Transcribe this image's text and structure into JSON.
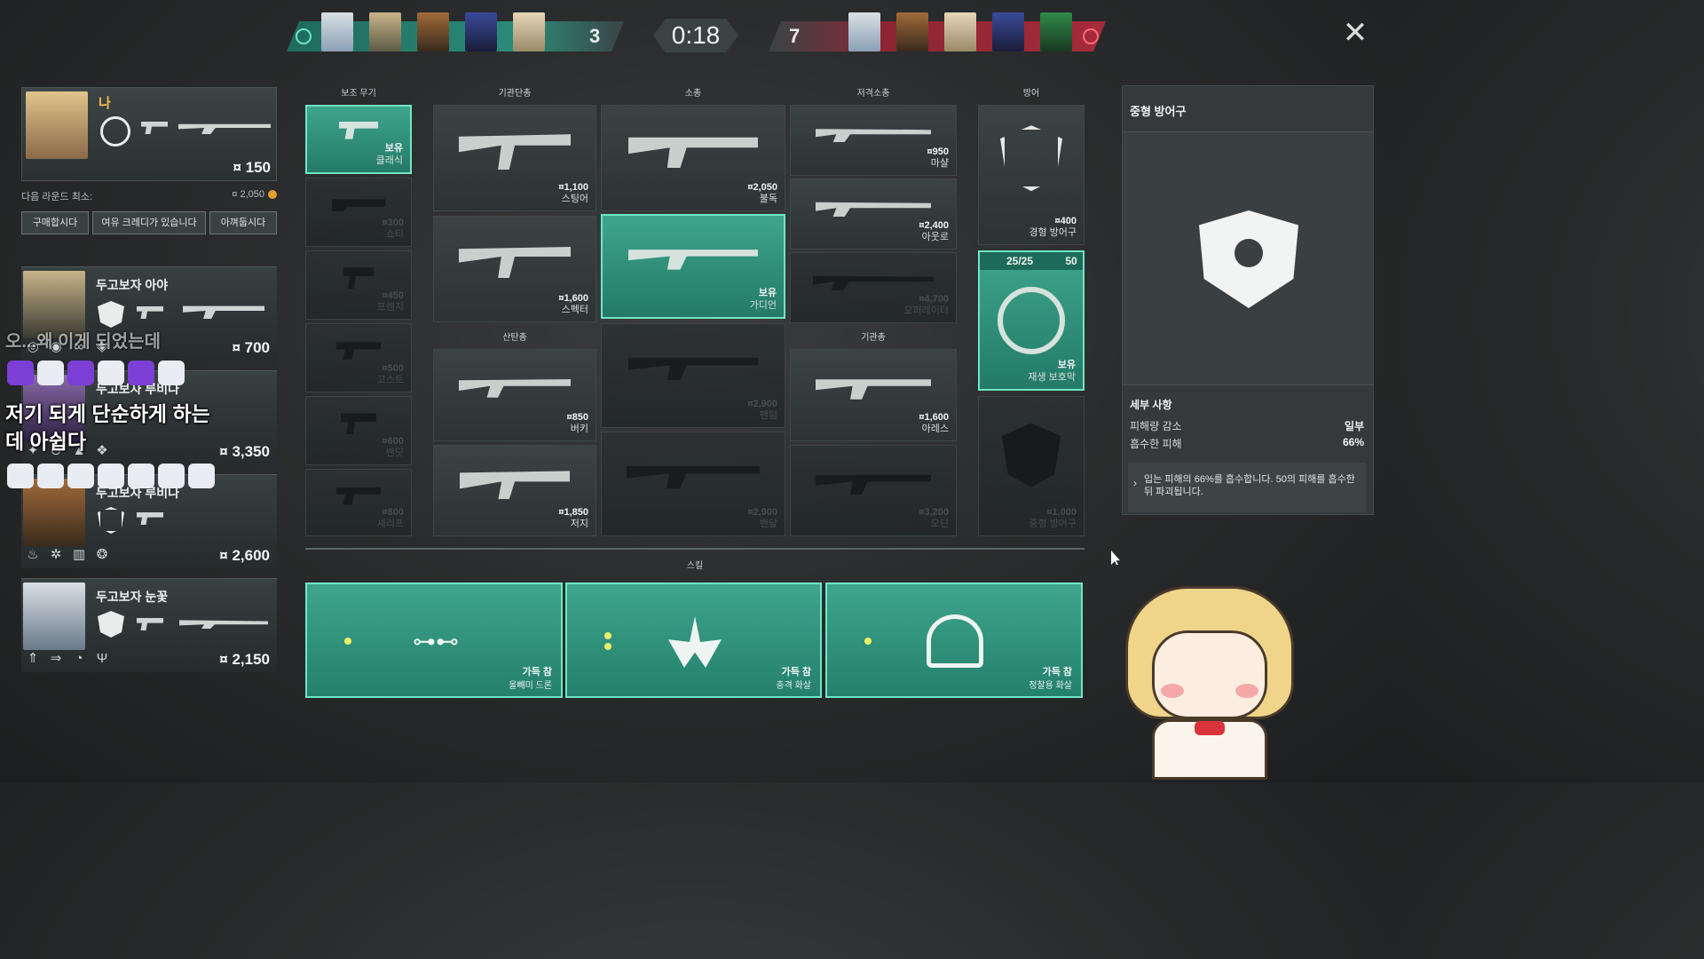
{
  "scoreboard": {
    "left_score": "3",
    "right_score": "7",
    "timer": "0:18",
    "close_label": "✕"
  },
  "player": {
    "name": "나",
    "credits": "¤ 150",
    "next_round_label": "다음 라운드 최소:",
    "next_round_value": "¤ 2,050",
    "buttons": [
      "구매합시다",
      "여유 크레디가 있습니다",
      "아껴둡시다"
    ]
  },
  "teammates": [
    {
      "name": "두고보자 아야",
      "credits": "¤ 700"
    },
    {
      "name": "두고보자 루비나",
      "credits": "¤ 3,350"
    },
    {
      "name": "두고보자 루비나",
      "credits": "¤ 2,600"
    },
    {
      "name": "두고보자 눈꽃",
      "credits": "¤ 2,150"
    }
  ],
  "categories": {
    "sidearms": "보조 무기",
    "smgs": "기관단총",
    "rifles": "소총",
    "snipers": "저격소총",
    "armor": "방어",
    "shotguns": "산탄총",
    "mgs": "기관총",
    "skills": "스킬"
  },
  "sidearms": [
    {
      "price": "보유",
      "name": "클래식"
    },
    {
      "price": "¤300",
      "name": "쇼티"
    },
    {
      "price": "¤450",
      "name": "프렌지"
    },
    {
      "price": "¤500",
      "name": "고스트"
    },
    {
      "price": "¤600",
      "name": "밴딧"
    },
    {
      "price": "¤800",
      "name": "셰리프"
    }
  ],
  "smgs": [
    {
      "price": "¤1,100",
      "name": "스팅어"
    },
    {
      "price": "¤1,600",
      "name": "스펙터"
    }
  ],
  "shotguns": [
    {
      "price": "¤850",
      "name": "버키"
    },
    {
      "price": "¤1,850",
      "name": "저지"
    }
  ],
  "rifles": [
    {
      "price": "¤2,050",
      "name": "불독"
    },
    {
      "price": "보유",
      "name": "가디언"
    },
    {
      "price": "¤2,900",
      "name": "팬텀"
    },
    {
      "price": "¤2,900",
      "name": "밴달"
    }
  ],
  "snipers": [
    {
      "price": "¤950",
      "name": "마샬"
    },
    {
      "price": "¤2,400",
      "name": "아웃로"
    },
    {
      "price": "¤4,700",
      "name": "오퍼레이터"
    }
  ],
  "mgs": [
    {
      "price": "¤1,600",
      "name": "아레스"
    },
    {
      "price": "¤3,200",
      "name": "오딘"
    }
  ],
  "armor": [
    {
      "price": "¤400",
      "name": "경형 방어구"
    },
    {
      "price": "보유",
      "name": "재생 보호막",
      "badge_left": "25/25",
      "badge_right": "50"
    },
    {
      "price": "¤1,000",
      "name": "중형 방어구"
    }
  ],
  "skills": [
    {
      "status": "가득 참",
      "name": "올빼미 드론"
    },
    {
      "status": "가득 참",
      "name": "충격 화살"
    },
    {
      "status": "가득 참",
      "name": "정찰용 화살"
    }
  ],
  "detail": {
    "title": "중형 방어구",
    "section": "세부 사항",
    "rows": [
      {
        "label": "피해량 감소",
        "value": "일부"
      },
      {
        "label": "흡수한 피해",
        "value": "66%"
      }
    ],
    "description": "입는 피해의 66%를 흡수합니다. 50의 피해를 흡수한 뒤 파괴됩니다."
  },
  "chat": {
    "line1": "오...왜 이게 되었는데",
    "line2": "저기 되게 단순하게 하는",
    "line3": "데 아쉽다"
  },
  "colors": {
    "owned_bg": "#2f9079",
    "owned_border": "#6fe6c6",
    "team_left": "#2b8c79",
    "team_right": "#a52b3a",
    "player_name": "#f1c24a"
  }
}
